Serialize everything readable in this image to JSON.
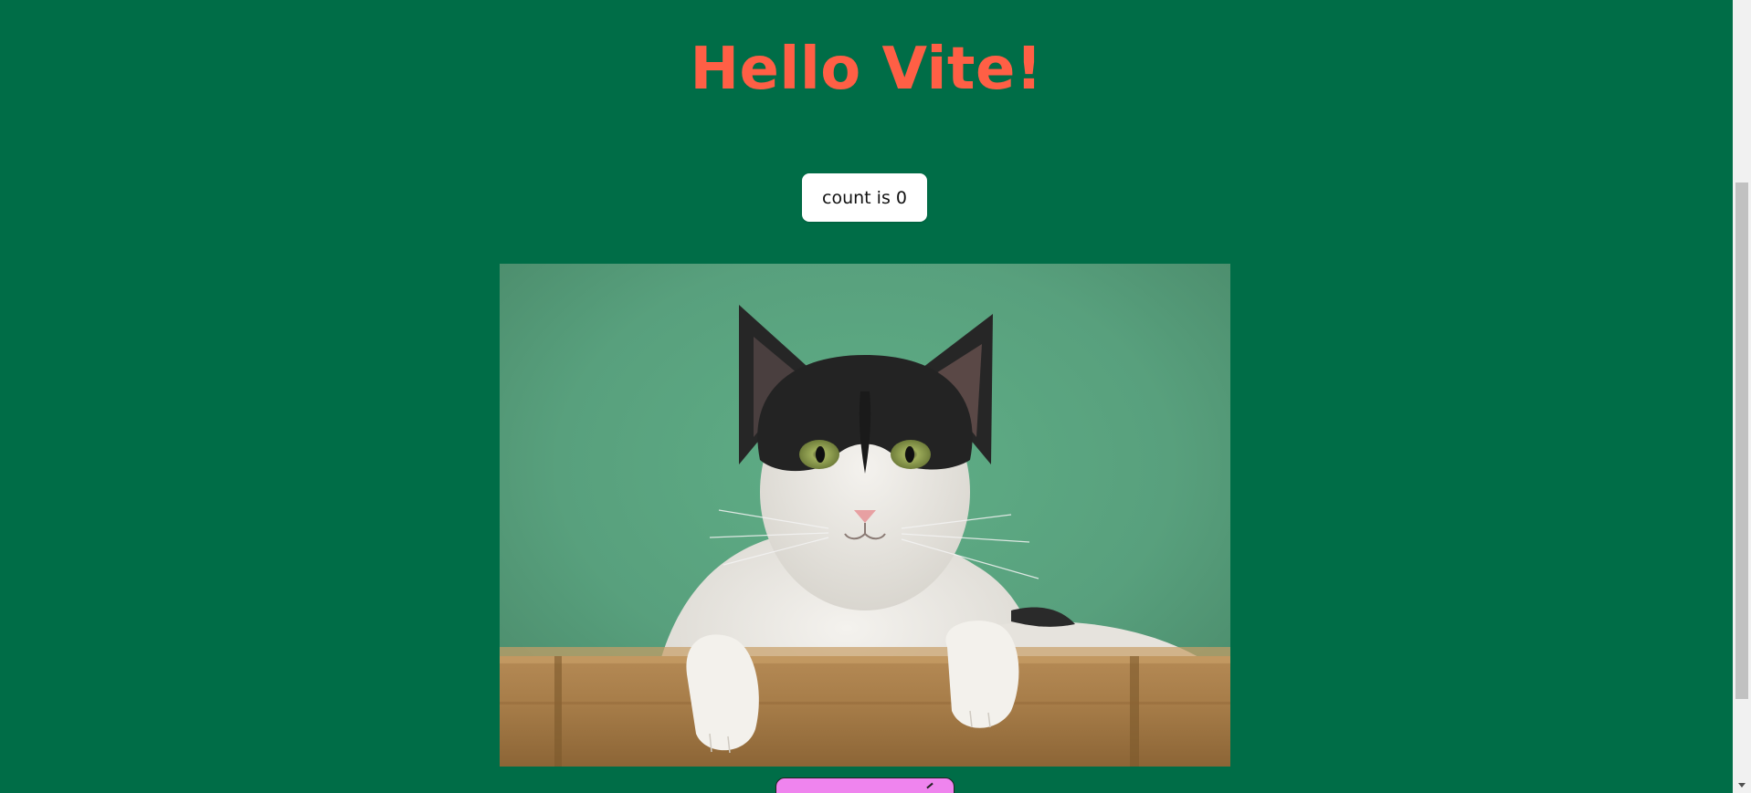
{
  "page": {
    "title": "Hello Vite!",
    "title_color": "#ff5f45",
    "background_color": "#006d47"
  },
  "counter": {
    "label": "count is 0",
    "value": 0
  },
  "image": {
    "subject": "cat"
  },
  "bottom_button": {
    "color": "#ef84ee"
  },
  "scrollbar": {
    "icon": "chevron-down-icon"
  }
}
